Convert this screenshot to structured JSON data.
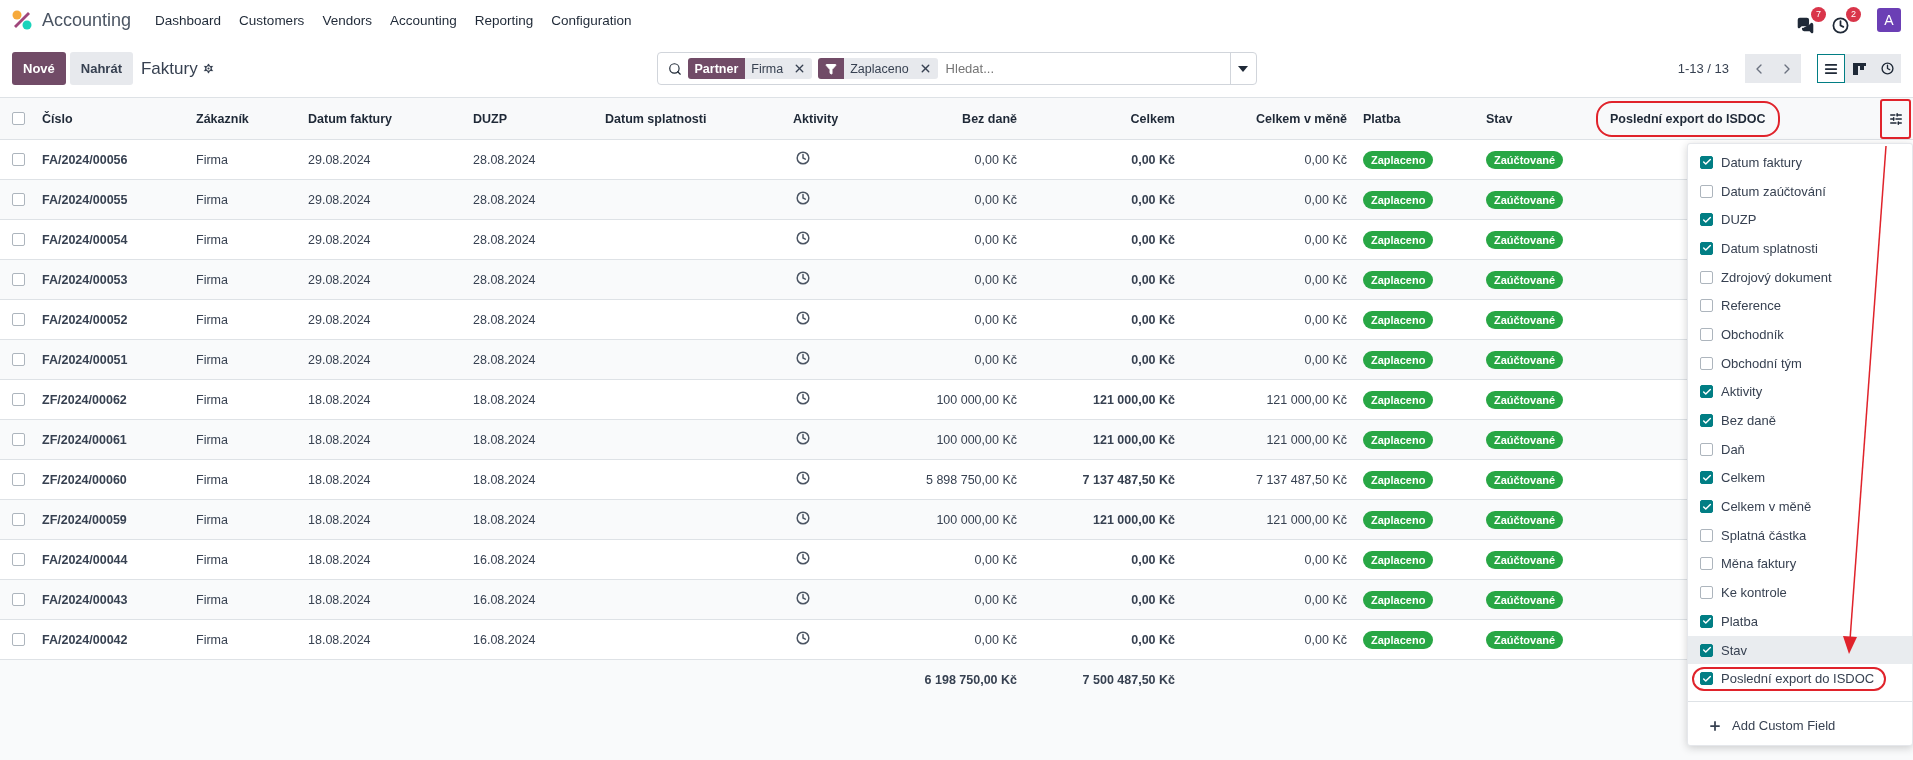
{
  "app": {
    "name": "Accounting",
    "menu": [
      "Dashboard",
      "Customers",
      "Vendors",
      "Accounting",
      "Reporting",
      "Configuration"
    ]
  },
  "systray": {
    "messages_count": "7",
    "activities_count": "2",
    "avatar": "A"
  },
  "control_panel": {
    "new_button": "Nové",
    "upload_button": "Nahrát",
    "title": "Faktury"
  },
  "search": {
    "facets": [
      {
        "kind": "field",
        "label": "Partner",
        "value": "Firma"
      },
      {
        "kind": "filter",
        "value": "Zaplaceno"
      }
    ],
    "placeholder": "Hledat..."
  },
  "pager": "1-13 / 13",
  "views": [
    {
      "kind": "list",
      "selected": true
    },
    {
      "kind": "kanban",
      "selected": false
    },
    {
      "kind": "activity",
      "selected": false
    }
  ],
  "table": {
    "all_selected": false,
    "columns": [
      {
        "label": "Číslo",
        "kind": "bold",
        "circled": false
      },
      {
        "label": "Zákazník",
        "kind": "text",
        "circled": false
      },
      {
        "label": "Datum faktury",
        "kind": "text",
        "circled": false
      },
      {
        "label": "DUZP",
        "kind": "text",
        "circled": false
      },
      {
        "label": "Datum splatnosti",
        "kind": "text",
        "circled": false
      },
      {
        "label": "Aktivity",
        "kind": "activity",
        "circled": false
      },
      {
        "label": "Bez daně",
        "kind": "money",
        "circled": false,
        "total": "6 198 750,00 Kč"
      },
      {
        "label": "Celkem",
        "kind": "money_bold",
        "circled": false,
        "total": "7 500 487,50 Kč"
      },
      {
        "label": "Celkem v měně",
        "kind": "money",
        "circled": false
      },
      {
        "label": "Platba",
        "kind": "badge",
        "circled": false
      },
      {
        "label": "Stav",
        "kind": "badge",
        "circled": false
      },
      {
        "label": "Poslední export do ISDOC",
        "kind": "text",
        "circled": true
      }
    ],
    "rows": [
      {
        "selected": false,
        "cells": [
          "FA/2024/00056",
          "Firma",
          "29.08.2024",
          "28.08.2024",
          null,
          null,
          "0,00 Kč",
          "0,00 Kč",
          "0,00 Kč",
          "Zaplaceno",
          "Zaúčtované"
        ]
      },
      {
        "selected": false,
        "cells": [
          "FA/2024/00055",
          "Firma",
          "29.08.2024",
          "28.08.2024",
          null,
          null,
          "0,00 Kč",
          "0,00 Kč",
          "0,00 Kč",
          "Zaplaceno",
          "Zaúčtované"
        ]
      },
      {
        "selected": false,
        "cells": [
          "FA/2024/00054",
          "Firma",
          "29.08.2024",
          "28.08.2024",
          null,
          null,
          "0,00 Kč",
          "0,00 Kč",
          "0,00 Kč",
          "Zaplaceno",
          "Zaúčtované"
        ]
      },
      {
        "selected": false,
        "cells": [
          "FA/2024/00053",
          "Firma",
          "29.08.2024",
          "28.08.2024",
          null,
          null,
          "0,00 Kč",
          "0,00 Kč",
          "0,00 Kč",
          "Zaplaceno",
          "Zaúčtované"
        ]
      },
      {
        "selected": false,
        "cells": [
          "FA/2024/00052",
          "Firma",
          "29.08.2024",
          "28.08.2024",
          null,
          null,
          "0,00 Kč",
          "0,00 Kč",
          "0,00 Kč",
          "Zaplaceno",
          "Zaúčtované"
        ]
      },
      {
        "selected": false,
        "cells": [
          "FA/2024/00051",
          "Firma",
          "29.08.2024",
          "28.08.2024",
          null,
          null,
          "0,00 Kč",
          "0,00 Kč",
          "0,00 Kč",
          "Zaplaceno",
          "Zaúčtované"
        ]
      },
      {
        "selected": false,
        "cells": [
          "ZF/2024/00062",
          "Firma",
          "18.08.2024",
          "18.08.2024",
          null,
          null,
          "100 000,00 Kč",
          "121 000,00 Kč",
          "121 000,00 Kč",
          "Zaplaceno",
          "Zaúčtované"
        ]
      },
      {
        "selected": false,
        "cells": [
          "ZF/2024/00061",
          "Firma",
          "18.08.2024",
          "18.08.2024",
          null,
          null,
          "100 000,00 Kč",
          "121 000,00 Kč",
          "121 000,00 Kč",
          "Zaplaceno",
          "Zaúčtované"
        ]
      },
      {
        "selected": false,
        "cells": [
          "ZF/2024/00060",
          "Firma",
          "18.08.2024",
          "18.08.2024",
          null,
          null,
          "5 898 750,00 Kč",
          "7 137 487,50 Kč",
          "7 137 487,50 Kč",
          "Zaplaceno",
          "Zaúčtované"
        ]
      },
      {
        "selected": false,
        "cells": [
          "ZF/2024/00059",
          "Firma",
          "18.08.2024",
          "18.08.2024",
          null,
          null,
          "100 000,00 Kč",
          "121 000,00 Kč",
          "121 000,00 Kč",
          "Zaplaceno",
          "Zaúčtované"
        ]
      },
      {
        "selected": false,
        "cells": [
          "FA/2024/00044",
          "Firma",
          "18.08.2024",
          "16.08.2024",
          null,
          null,
          "0,00 Kč",
          "0,00 Kč",
          "0,00 Kč",
          "Zaplaceno",
          "Zaúčtované"
        ]
      },
      {
        "selected": false,
        "cells": [
          "FA/2024/00043",
          "Firma",
          "18.08.2024",
          "16.08.2024",
          null,
          null,
          "0,00 Kč",
          "0,00 Kč",
          "0,00 Kč",
          "Zaplaceno",
          "Zaúčtované"
        ]
      },
      {
        "selected": false,
        "cells": [
          "FA/2024/00042",
          "Firma",
          "18.08.2024",
          "16.08.2024",
          null,
          null,
          "0,00 Kč",
          "0,00 Kč",
          "0,00 Kč",
          "Zaplaceno",
          "Zaúčtované"
        ]
      }
    ]
  },
  "column_picker": {
    "items": [
      {
        "label": "Datum faktury",
        "checked": true,
        "hovered": false,
        "circled": false
      },
      {
        "label": "Datum zaúčtování",
        "checked": false,
        "hovered": false,
        "circled": false
      },
      {
        "label": "DUZP",
        "checked": true,
        "hovered": false,
        "circled": false
      },
      {
        "label": "Datum splatnosti",
        "checked": true,
        "hovered": false,
        "circled": false
      },
      {
        "label": "Zdrojový dokument",
        "checked": false,
        "hovered": false,
        "circled": false
      },
      {
        "label": "Reference",
        "checked": false,
        "hovered": false,
        "circled": false
      },
      {
        "label": "Obchodník",
        "checked": false,
        "hovered": false,
        "circled": false
      },
      {
        "label": "Obchodní tým",
        "checked": false,
        "hovered": false,
        "circled": false
      },
      {
        "label": "Aktivity",
        "checked": true,
        "hovered": false,
        "circled": false
      },
      {
        "label": "Bez daně",
        "checked": true,
        "hovered": false,
        "circled": false
      },
      {
        "label": "Daň",
        "checked": false,
        "hovered": false,
        "circled": false
      },
      {
        "label": "Celkem",
        "checked": true,
        "hovered": false,
        "circled": false
      },
      {
        "label": "Celkem v měně",
        "checked": true,
        "hovered": false,
        "circled": false
      },
      {
        "label": "Splatná částka",
        "checked": false,
        "hovered": false,
        "circled": false
      },
      {
        "label": "Měna faktury",
        "checked": false,
        "hovered": false,
        "circled": false
      },
      {
        "label": "Ke kontrole",
        "checked": false,
        "hovered": false,
        "circled": false
      },
      {
        "label": "Platba",
        "checked": true,
        "hovered": false,
        "circled": false
      },
      {
        "label": "Stav",
        "checked": true,
        "hovered": true,
        "circled": false
      },
      {
        "label": "Poslední export do ISDOC",
        "checked": true,
        "hovered": false,
        "circled": true
      }
    ],
    "add_field": "Add Custom Field"
  }
}
